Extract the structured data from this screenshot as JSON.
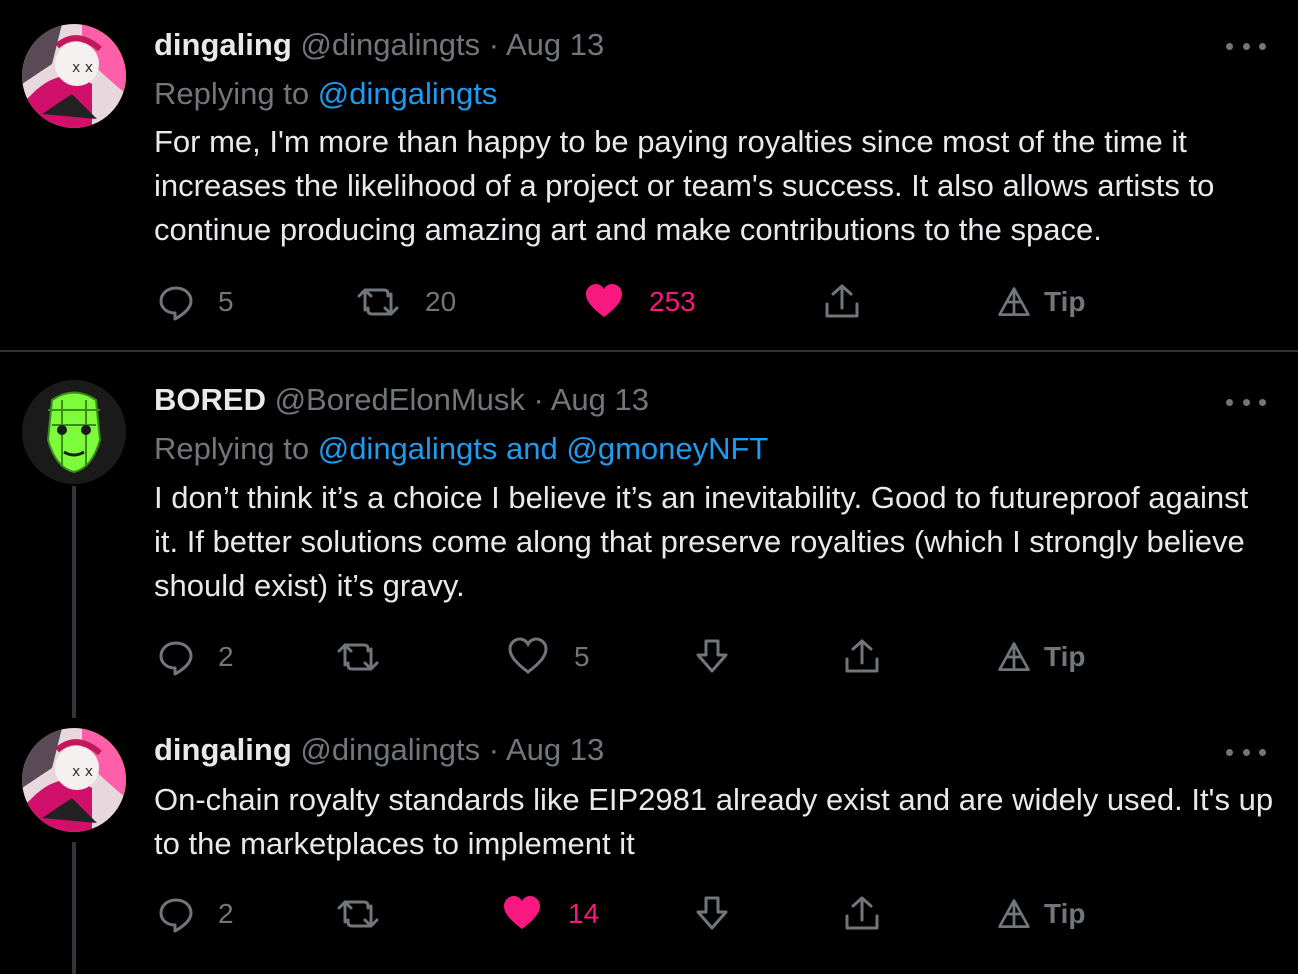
{
  "tweets": [
    {
      "name": "dingaling",
      "handle": "@dingalingts",
      "sep": " · ",
      "date": "Aug 13",
      "replying_prefix": "Replying to ",
      "replying_to": "@dingalingts",
      "text": "For me, I'm more than happy to be paying royalties since most of the time it increases the likelihood of a project or team's success. It also allows artists to continue producing amazing art and make contributions to the space.",
      "replies": "5",
      "retweets": "20",
      "likes": "253",
      "liked": true,
      "tip": "Tip"
    },
    {
      "name": "BORED",
      "handle": "@BoredElonMusk",
      "sep": " · ",
      "date": "Aug 13",
      "replying_prefix": "Replying to ",
      "replying_to": "@dingalingts and @gmoneyNFT",
      "text": "I don’t think it’s a choice I believe it’s an inevitability. Good to futureproof against it. If better solutions come along that preserve royalties (which I strongly believe should exist) it’s gravy.",
      "replies": "2",
      "retweets": "",
      "likes": "5",
      "liked": false,
      "tip": "Tip"
    },
    {
      "name": "dingaling",
      "handle": "@dingalingts",
      "sep": " · ",
      "date": "Aug 13",
      "text": "On-chain royalty standards like EIP2981 already exist and are widely used. It's up to the marketplaces to implement it",
      "replies": "2",
      "retweets": "",
      "likes": "14",
      "liked": true,
      "tip": "Tip"
    }
  ],
  "colors": {
    "accent": "#1d9bf0",
    "like": "#f91880",
    "muted": "#71767b",
    "background": "#000000"
  }
}
